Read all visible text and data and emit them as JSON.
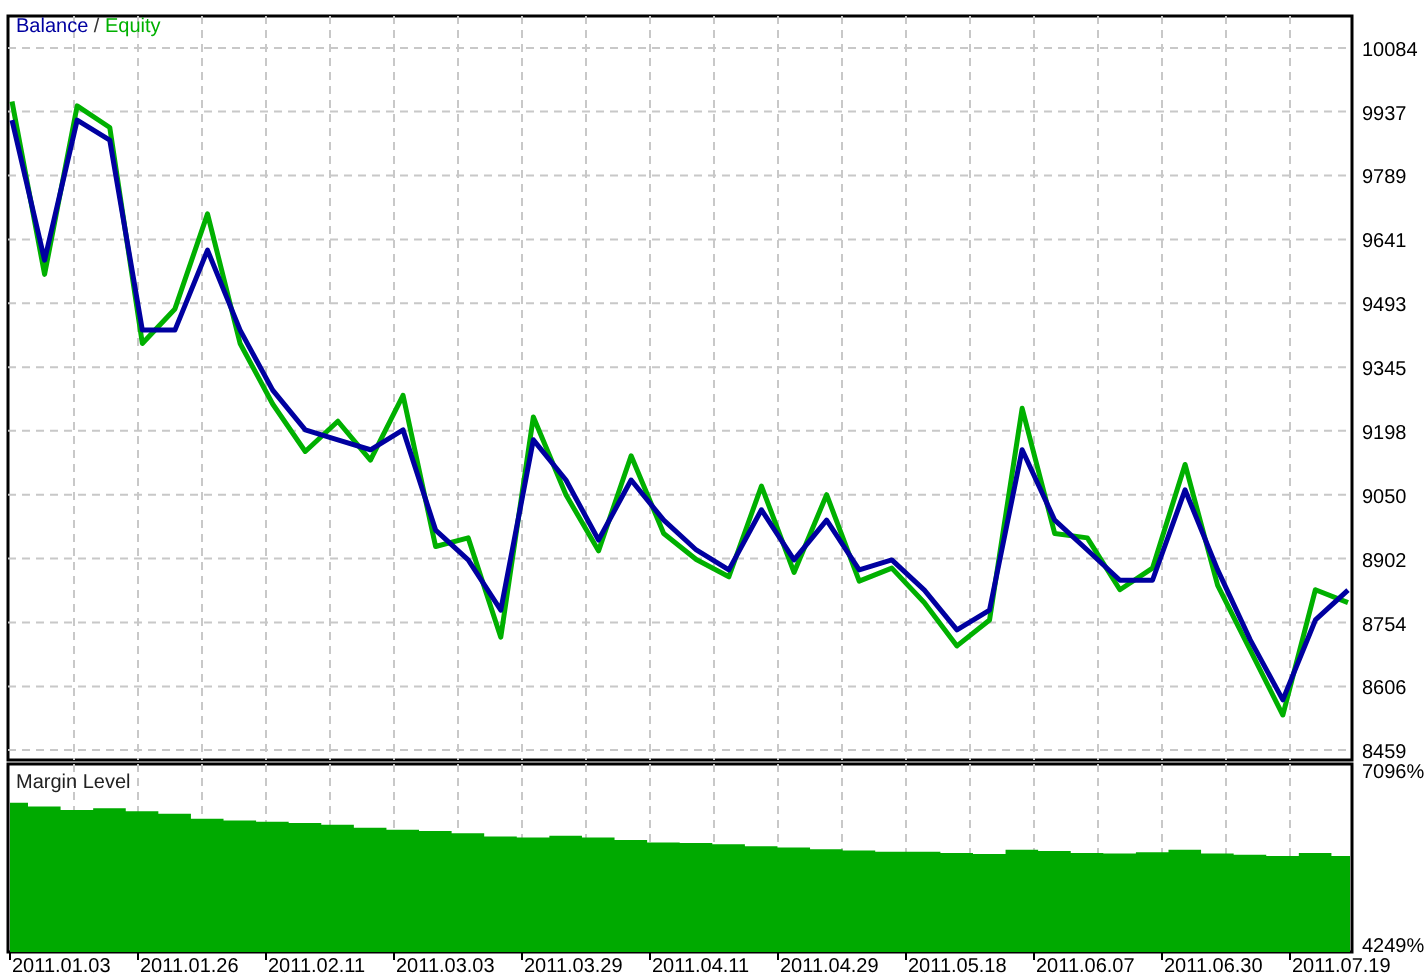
{
  "equity_chart": {
    "legend_separator": "/",
    "chart_data": {
      "type": "line",
      "grid": true,
      "series": [
        {
          "name": "Balance",
          "color": "#0000a0",
          "values": [
            9917,
            9593,
            9917,
            9871,
            9431,
            9431,
            9616,
            9431,
            9292,
            9200,
            9177,
            9154,
            9200,
            8968,
            8899,
            8783,
            9177,
            9084,
            8945,
            9084,
            8991,
            8922,
            8876,
            9015,
            8899,
            8991,
            8876,
            8899,
            8829,
            8737,
            8783,
            9154,
            8991,
            8922,
            8852,
            8852,
            9061,
            8876,
            8714,
            8575,
            8760,
            8829
          ]
        },
        {
          "name": "Equity",
          "color": "#00b000",
          "values": [
            9960,
            9560,
            9950,
            9900,
            9400,
            9480,
            9700,
            9400,
            9260,
            9150,
            9220,
            9130,
            9280,
            8930,
            8950,
            8720,
            9230,
            9050,
            8920,
            9140,
            8960,
            8900,
            8860,
            9070,
            8870,
            9050,
            8850,
            8880,
            8800,
            8700,
            8760,
            9250,
            8960,
            8950,
            8830,
            8880,
            9120,
            8840,
            8690,
            8540,
            8830,
            8800
          ]
        }
      ],
      "ylim": [
        8459,
        10084
      ],
      "yticks": [
        10084,
        9937,
        9789,
        9641,
        9493,
        9345,
        9198,
        9050,
        8902,
        8754,
        8606,
        8459
      ]
    }
  },
  "margin_chart": {
    "chart_data": {
      "type": "area",
      "title": "Margin Level",
      "grid": true,
      "series": [
        {
          "color": "#00aa00",
          "values": [
            6560,
            6500,
            6440,
            6470,
            6420,
            6380,
            6300,
            6270,
            6250,
            6230,
            6200,
            6150,
            6120,
            6100,
            6060,
            6010,
            5990,
            6020,
            5990,
            5950,
            5910,
            5900,
            5880,
            5850,
            5830,
            5800,
            5780,
            5760,
            5760,
            5740,
            5720,
            5790,
            5770,
            5740,
            5730,
            5750,
            5790,
            5730,
            5710,
            5690,
            5740,
            5690
          ]
        }
      ],
      "ylim": [
        4118,
        7178
      ],
      "yticks": [
        {
          "value": 4249,
          "label": "4249%"
        },
        {
          "value": 7096,
          "label": "7096%"
        }
      ]
    }
  },
  "time_axis": {
    "labels": [
      "2011.01.03",
      "2011.01.26",
      "2011.02.11",
      "2011.03.03",
      "2011.03.29",
      "2011.04.11",
      "2011.04.29",
      "2011.05.18",
      "2011.06.07",
      "2011.06.30",
      "2011.07.19"
    ]
  }
}
